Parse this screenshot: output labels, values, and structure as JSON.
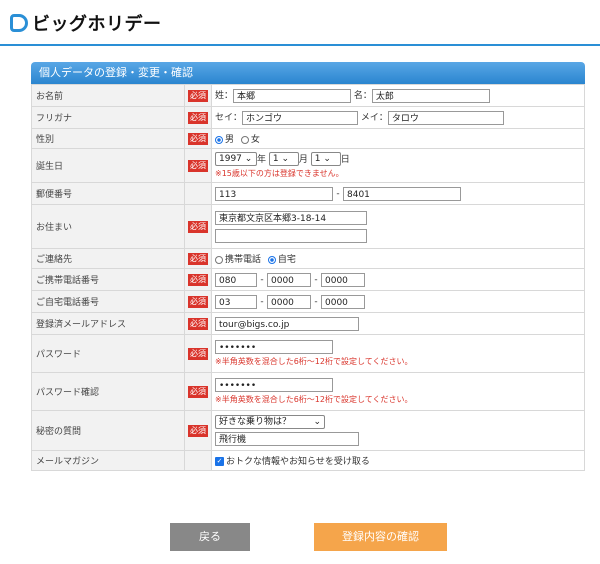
{
  "brand": {
    "name": "ビッグホリデー"
  },
  "panel": {
    "title": "個人データの登録・変更・確認"
  },
  "required_label": "必須",
  "rows": {
    "name": {
      "label": "お名前",
      "sei_label": "姓：",
      "sei_value": "本郷",
      "mei_label": "名：",
      "mei_value": "太郎"
    },
    "furigana": {
      "label": "フリガナ",
      "sei_label": "セイ：",
      "sei_value": "ホンゴウ",
      "mei_label": "メイ：",
      "mei_value": "タロウ"
    },
    "gender": {
      "label": "性別",
      "male": "男",
      "female": "女",
      "selected": "男"
    },
    "birthday": {
      "label": "誕生日",
      "year": "1997",
      "year_unit": "年",
      "month": "1",
      "month_unit": "月",
      "day": "1",
      "day_unit": "日",
      "note": "※15歳以下の方は登録できません。"
    },
    "postal": {
      "label": "郵便番号",
      "part1": "113",
      "dash": "-",
      "part2": "8401"
    },
    "address": {
      "label": "お住まい",
      "line1": "東京都文京区本郷3-18-14",
      "line2": ""
    },
    "contact": {
      "label": "ご連絡先",
      "mobile": "携帯電話",
      "home": "自宅",
      "selected": "自宅"
    },
    "mobile_phone": {
      "label": "ご携帯電話番号",
      "p1": "080",
      "p2": "0000",
      "p3": "0000",
      "dash": "-"
    },
    "home_phone": {
      "label": "ご自宅電話番号",
      "p1": "03",
      "p2": "0000",
      "p3": "0000",
      "dash": "-"
    },
    "email": {
      "label": "登録済メールアドレス",
      "value": "tour@bigs.co.jp"
    },
    "password": {
      "label": "パスワード",
      "value": "•••••••",
      "note": "※半角英数を混合した6桁〜12桁で設定してください。"
    },
    "password_confirm": {
      "label": "パスワード確認",
      "value": "•••••••",
      "note": "※半角英数を混合した6桁〜12桁で設定してください。"
    },
    "secret": {
      "label": "秘密の質問",
      "question": "好きな乗り物は？",
      "answer": "飛行機"
    },
    "newsletter": {
      "label": "メールマガジン",
      "text": "おトクな情報やお知らせを受け取る",
      "checked": true
    }
  },
  "buttons": {
    "back": "戻る",
    "confirm": "登録内容の確認"
  }
}
